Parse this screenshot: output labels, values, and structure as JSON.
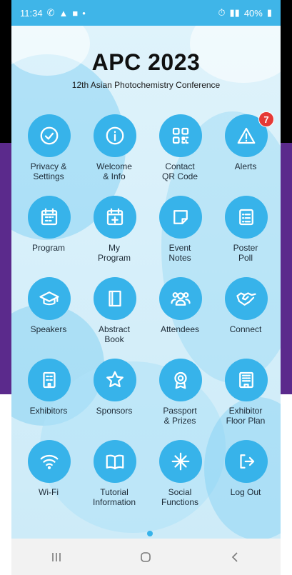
{
  "status_bar": {
    "time": "11:34",
    "battery": "40%",
    "left_icons": [
      "whatsapp-icon",
      "ring-icon",
      "gallery-icon",
      "dot-icon"
    ],
    "right_icons": [
      "alarm-icon",
      "signal-icon"
    ]
  },
  "header": {
    "title": "APC 2023",
    "subtitle": "12th Asian Photochemistry Conference"
  },
  "tiles": [
    {
      "label": "Privacy &\nSettings",
      "icon": "check-circle-icon"
    },
    {
      "label": "Welcome\n& Info",
      "icon": "info-icon"
    },
    {
      "label": "Contact\nQR Code",
      "icon": "qr-code-icon"
    },
    {
      "label": "Alerts",
      "icon": "warning-icon",
      "badge": "7"
    },
    {
      "label": "Program",
      "icon": "calendar-grid-icon"
    },
    {
      "label": "My\nProgram",
      "icon": "calendar-plus-icon"
    },
    {
      "label": "Event\nNotes",
      "icon": "sticky-note-icon"
    },
    {
      "label": "Poster\nPoll",
      "icon": "list-icon"
    },
    {
      "label": "Speakers",
      "icon": "graduation-cap-icon"
    },
    {
      "label": "Abstract\nBook",
      "icon": "book-icon"
    },
    {
      "label": "Attendees",
      "icon": "people-icon"
    },
    {
      "label": "Connect",
      "icon": "handshake-icon"
    },
    {
      "label": "Exhibitors",
      "icon": "building-icon"
    },
    {
      "label": "Sponsors",
      "icon": "star-icon"
    },
    {
      "label": "Passport\n& Prizes",
      "icon": "medal-icon"
    },
    {
      "label": "Exhibitor\nFloor Plan",
      "icon": "floor-plan-icon"
    },
    {
      "label": "Wi-Fi",
      "icon": "wifi-icon"
    },
    {
      "label": "Tutorial\nInformation",
      "icon": "open-book-icon"
    },
    {
      "label": "Social\nFunctions",
      "icon": "sparkle-icon"
    },
    {
      "label": "Log Out",
      "icon": "logout-icon"
    }
  ],
  "nav_bar": {
    "items": [
      "recents-button",
      "home-button",
      "back-button"
    ]
  },
  "colors": {
    "accent": "#37b3ea",
    "badge": "#e53935",
    "status_bar": "#3fb5e8"
  }
}
